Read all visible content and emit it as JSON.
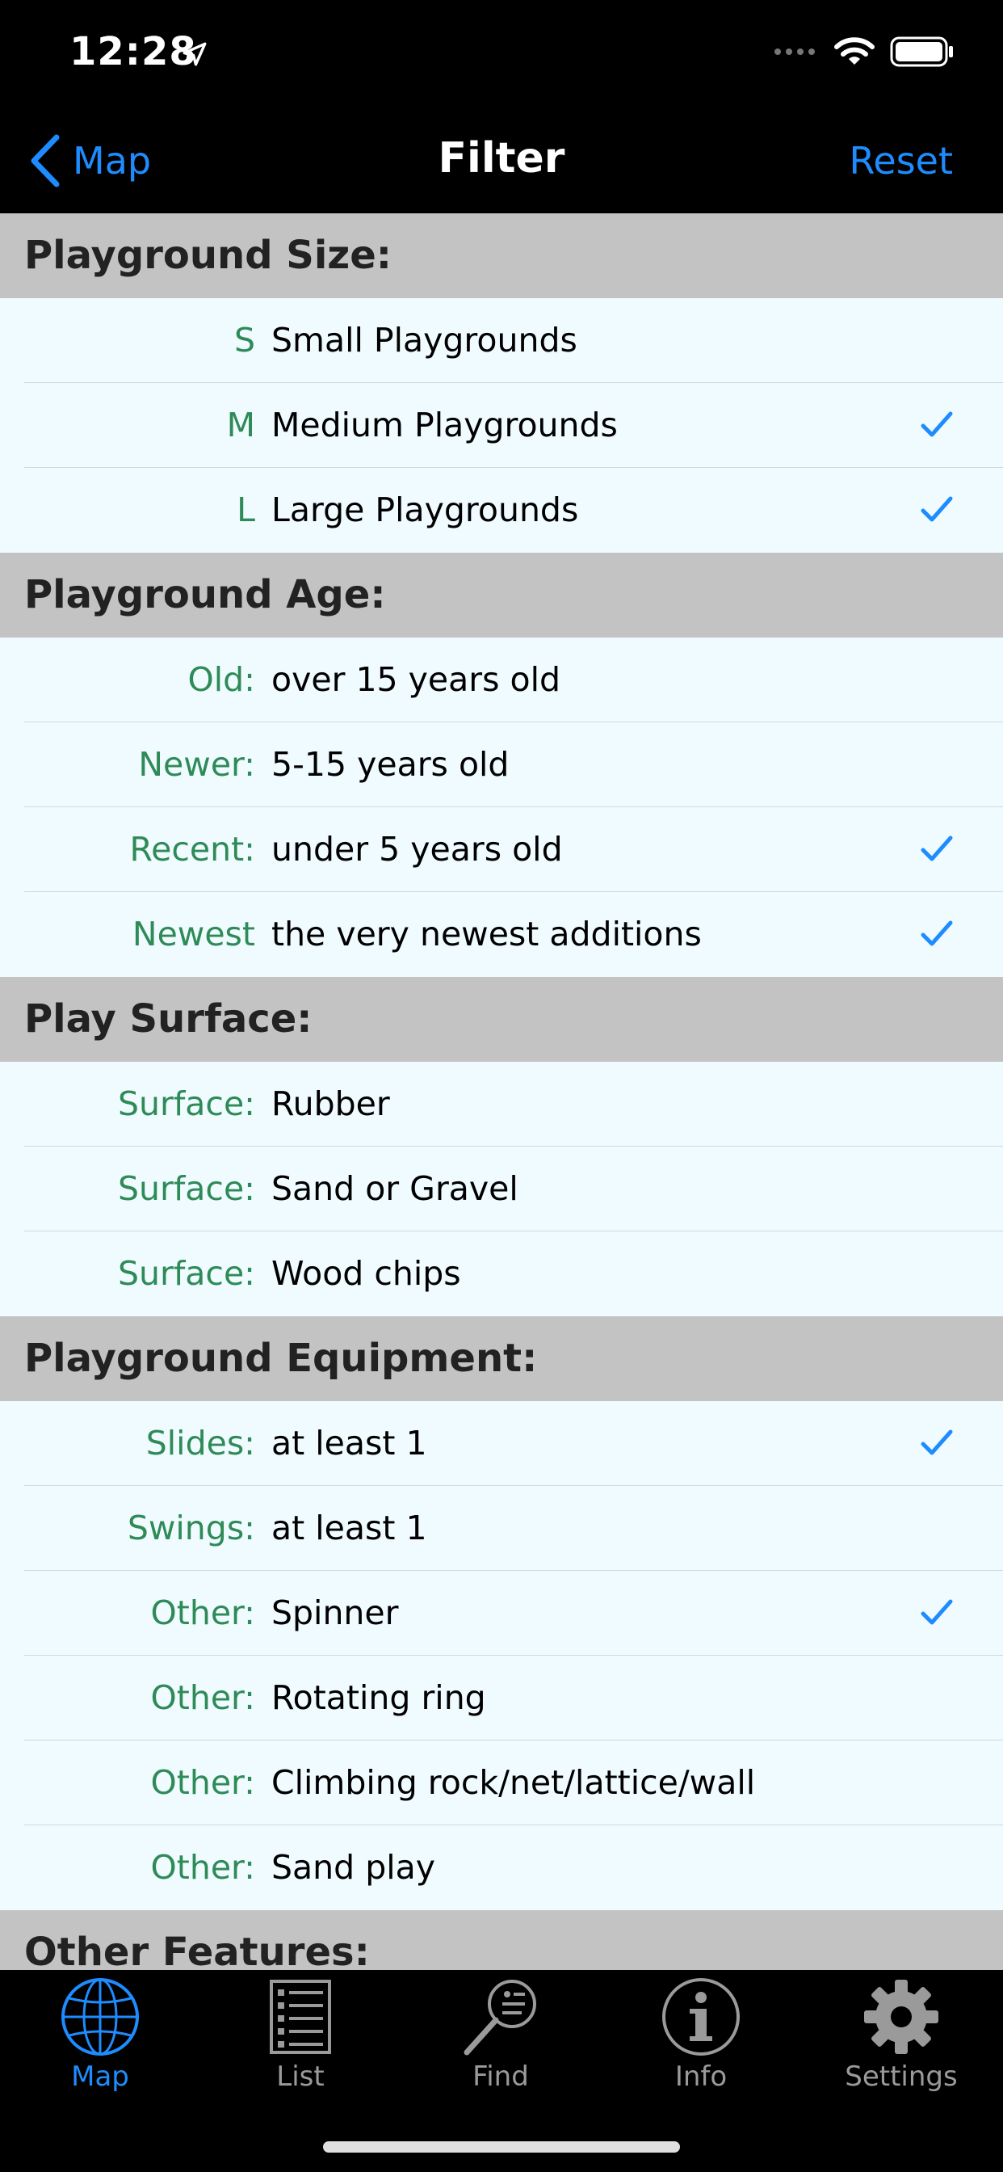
{
  "status_bar": {
    "time": "12:28"
  },
  "nav": {
    "back_label": "Map",
    "title": "Filter",
    "reset_label": "Reset"
  },
  "sections": [
    {
      "title": "Playground Size:",
      "rows": [
        {
          "key": "S",
          "value": "Small Playgrounds",
          "checked": false
        },
        {
          "key": "M",
          "value": "Medium Playgrounds",
          "checked": true
        },
        {
          "key": "L",
          "value": "Large Playgrounds",
          "checked": true
        }
      ]
    },
    {
      "title": "Playground Age:",
      "rows": [
        {
          "key": "Old:",
          "value": "over 15 years old",
          "checked": false
        },
        {
          "key": "Newer:",
          "value": "5-15 years old",
          "checked": false
        },
        {
          "key": "Recent:",
          "value": "under 5 years old",
          "checked": true
        },
        {
          "key": "Newest",
          "value": "the very newest additions",
          "checked": true
        }
      ]
    },
    {
      "title": "Play Surface:",
      "rows": [
        {
          "key": "Surface:",
          "value": "Rubber",
          "checked": false
        },
        {
          "key": "Surface:",
          "value": "Sand or Gravel",
          "checked": false
        },
        {
          "key": "Surface:",
          "value": "Wood chips",
          "checked": false
        }
      ]
    },
    {
      "title": "Playground Equipment:",
      "rows": [
        {
          "key": "Slides:",
          "value": "at least 1",
          "checked": true
        },
        {
          "key": "Swings:",
          "value": "at least 1",
          "checked": false
        },
        {
          "key": "Other:",
          "value": "Spinner",
          "checked": true
        },
        {
          "key": "Other:",
          "value": "Rotating ring",
          "checked": false
        },
        {
          "key": "Other:",
          "value": "Climbing rock/net/lattice/wall",
          "checked": false
        },
        {
          "key": "Other:",
          "value": "Sand play",
          "checked": false
        }
      ]
    },
    {
      "title": "Other Features:",
      "rows": []
    }
  ],
  "tabs": [
    {
      "label": "Map",
      "icon": "globe-icon",
      "active": true
    },
    {
      "label": "List",
      "icon": "list-icon",
      "active": false
    },
    {
      "label": "Find",
      "icon": "magnifier-icon",
      "active": false
    },
    {
      "label": "Info",
      "icon": "info-icon",
      "active": false
    },
    {
      "label": "Settings",
      "icon": "gear-icon",
      "active": false
    }
  ],
  "colors": {
    "accent": "#1e8cff",
    "key_text": "#2e8b57",
    "section_bg": "#c3c3c3",
    "list_bg": "#f0fbff"
  }
}
